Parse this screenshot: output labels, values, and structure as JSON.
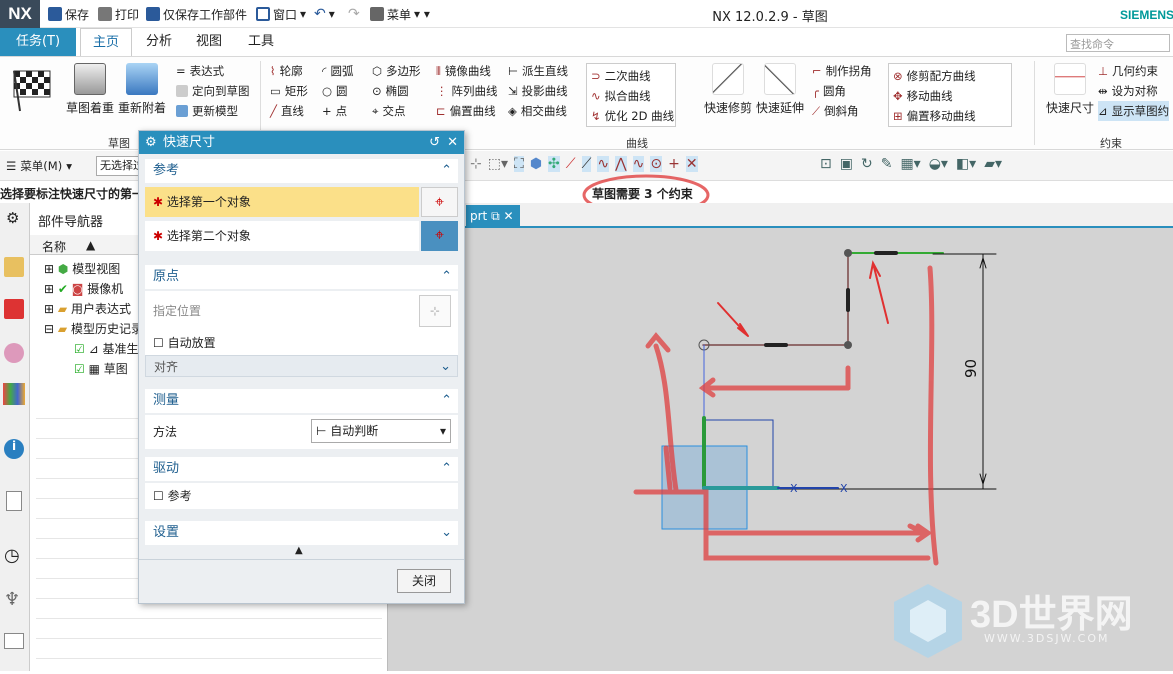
{
  "app": {
    "logo": "NX",
    "title": "NX 12.0.2.9 - 草图",
    "brand": "SIEMENS"
  },
  "quick_access": {
    "save": "保存",
    "print": "打印",
    "save_work": "仅保存工作部件",
    "window": "窗口",
    "menu": "菜单"
  },
  "ribbon_tabs": [
    "任务(T)",
    "主页",
    "分析",
    "视图",
    "工具"
  ],
  "command_search": {
    "placeholder": "查找命令"
  },
  "ribbon": {
    "sketch_group": {
      "label": "草图",
      "finish": "",
      "reorient": "草图着重",
      "reattach": "重新附着",
      "expr": "表达式",
      "orient_sketch": "定向到草图",
      "update_model": "更新模型"
    },
    "draw": {
      "profile": "轮廓",
      "arc": "圆弧",
      "polygon": "多边形",
      "rect": "矩形",
      "circle": "圆",
      "ellipse": "椭圆",
      "line": "直线",
      "point": "点",
      "intersect": "交点",
      "mirror": "镜像曲线",
      "pattern": "阵列曲线",
      "offset": "偏置曲线",
      "derived": "派生直线",
      "project": "投影曲线",
      "intersect_curve": "相交曲线"
    },
    "curve_group": {
      "label": "曲线",
      "conic": "二次曲线",
      "fit": "拟合曲线",
      "optimize": "优化 2D 曲线",
      "trim": "快速修剪",
      "extend": "快速延伸",
      "make_corner": "制作拐角",
      "fillet": "圆角",
      "chamfer": "倒斜角",
      "offset_move": "修剪配方曲线",
      "move_curve": "移动曲线",
      "offset_move_curve": "偏置移动曲线"
    },
    "constraint_group": {
      "label": "约束",
      "rapid_dim": "快速尺寸",
      "geo_con": "几何约束",
      "set_sym": "设为对称",
      "show_con": "显示草图约"
    }
  },
  "toolbar2": {
    "menu": "菜单(M)",
    "filter": "无选择过"
  },
  "prompt": "选择要标注快速尺寸的第一个",
  "status": "草图需要 3 个约束",
  "doc_tab": "prt",
  "navigator": {
    "title": "部件导航器",
    "col_name": "名称",
    "items": [
      "模型视图",
      "摄像机",
      "用户表达式",
      "模型历史记录",
      "基准生",
      "草图"
    ]
  },
  "dialog": {
    "title": "快速尺寸",
    "ref": {
      "header": "参考",
      "first": "选择第一个对象",
      "second": "选择第二个对象"
    },
    "origin": {
      "header": "原点",
      "specify": "指定位置",
      "auto": "自动放置",
      "align": "对齐"
    },
    "measure": {
      "header": "测量",
      "method_label": "方法",
      "method_value": "自动判断"
    },
    "driving": {
      "header": "驱动",
      "ref": "参考"
    },
    "settings": {
      "header": "设置"
    },
    "close": "关闭"
  },
  "dimension_label": "90",
  "watermark": {
    "text": "3D世界网",
    "url": "WWW.3DSJW.COM"
  }
}
